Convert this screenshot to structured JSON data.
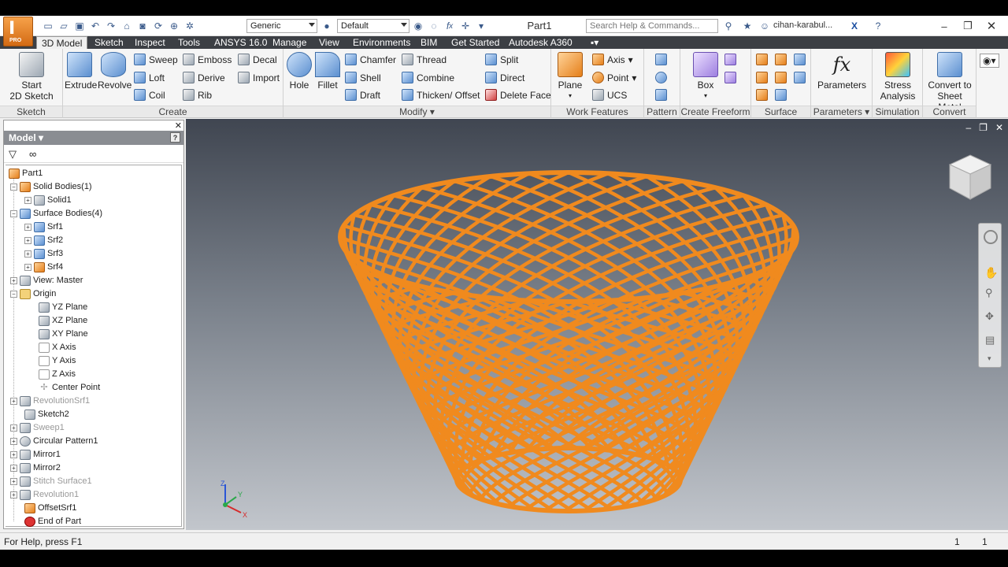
{
  "titlebar": {
    "pro_label": "PRO",
    "material": "Generic",
    "appearance": "Default",
    "document_title": "Part1",
    "search_placeholder": "Search Help & Commands...",
    "user": "cihan-karabul..."
  },
  "tabs": [
    "3D Model",
    "Sketch",
    "Inspect",
    "Tools",
    "ANSYS 16.0",
    "Manage",
    "View",
    "Environments",
    "BIM",
    "Get Started",
    "Autodesk A360"
  ],
  "ribbon": {
    "sketch": {
      "label": "Sketch",
      "start_l1": "Start",
      "start_l2": "2D Sketch"
    },
    "create": {
      "label": "Create",
      "extrude": "Extrude",
      "revolve": "Revolve",
      "sweep": "Sweep",
      "loft": "Loft",
      "coil": "Coil",
      "emboss": "Emboss",
      "derive": "Derive",
      "rib": "Rib",
      "decal": "Decal",
      "import": "Import"
    },
    "modify": {
      "label": "Modify",
      "hole": "Hole",
      "fillet": "Fillet",
      "chamfer": "Chamfer",
      "shell": "Shell",
      "draft": "Draft",
      "thread": "Thread",
      "combine": "Combine",
      "thicken": "Thicken/ Offset",
      "split": "Split",
      "direct": "Direct",
      "delete_face": "Delete Face"
    },
    "work": {
      "label": "Work Features",
      "plane": "Plane",
      "axis": "Axis",
      "point": "Point",
      "ucs": "UCS"
    },
    "pattern": {
      "label": "Pattern"
    },
    "freeform": {
      "label": "Create Freeform",
      "box": "Box"
    },
    "surface": {
      "label": "Surface"
    },
    "parameters": {
      "label": "Parameters",
      "btn": "Parameters"
    },
    "simulation": {
      "label": "Simulation",
      "l1": "Stress",
      "l2": "Analysis"
    },
    "convert": {
      "label": "Convert",
      "l1": "Convert to",
      "l2": "Sheet Metal"
    }
  },
  "browser": {
    "title": "Model",
    "help": "?",
    "nodes": [
      {
        "label": "Part1"
      },
      {
        "label": "Solid Bodies(1)"
      },
      {
        "label": "Solid1"
      },
      {
        "label": "Surface Bodies(4)"
      },
      {
        "label": "Srf1"
      },
      {
        "label": "Srf2"
      },
      {
        "label": "Srf3"
      },
      {
        "label": "Srf4"
      },
      {
        "label": "View: Master"
      },
      {
        "label": "Origin"
      },
      {
        "label": "YZ Plane"
      },
      {
        "label": "XZ Plane"
      },
      {
        "label": "XY Plane"
      },
      {
        "label": "X Axis"
      },
      {
        "label": "Y Axis"
      },
      {
        "label": "Z Axis"
      },
      {
        "label": "Center Point"
      },
      {
        "label": "RevolutionSrf1"
      },
      {
        "label": "Sketch2"
      },
      {
        "label": "Sweep1"
      },
      {
        "label": "Circular Pattern1"
      },
      {
        "label": "Mirror1"
      },
      {
        "label": "Mirror2"
      },
      {
        "label": "Stitch Surface1"
      },
      {
        "label": "Revolution1"
      },
      {
        "label": "OffsetSrf1"
      },
      {
        "label": "End of Part"
      }
    ]
  },
  "viewport": {
    "triad": {
      "x": "X",
      "y": "Y",
      "z": "Z"
    },
    "model_color": "#f08a1e"
  },
  "status": {
    "help_text": "For Help, press F1",
    "count1": "1",
    "count2": "1"
  }
}
